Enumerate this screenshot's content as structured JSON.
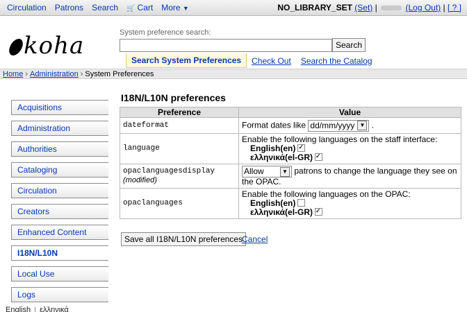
{
  "toolbar": {
    "nav": [
      {
        "label": "Circulation"
      },
      {
        "label": "Patrons"
      },
      {
        "label": "Search"
      },
      {
        "label": "Cart"
      },
      {
        "label": "More"
      }
    ],
    "library": "NO_LIBRARY_SET",
    "set_label": "(Set)",
    "logout_label": "(Log Out)",
    "help_label": "[ ? ]",
    "pipe": "|"
  },
  "logo_text": "koha",
  "search": {
    "label": "System preference search:",
    "value": "",
    "button": "Search",
    "tabs": [
      {
        "label": "Search System Preferences"
      },
      {
        "label": "Check Out"
      },
      {
        "label": "Search the Catalog"
      }
    ]
  },
  "breadcrumbs": [
    {
      "label": "Home"
    },
    {
      "label": "Administration"
    },
    {
      "label": "System Preferences"
    }
  ],
  "breadcrumb_sep": "›",
  "sidebar": {
    "items": [
      {
        "label": "Acquisitions"
      },
      {
        "label": "Administration"
      },
      {
        "label": "Authorities"
      },
      {
        "label": "Cataloging"
      },
      {
        "label": "Circulation"
      },
      {
        "label": "Creators"
      },
      {
        "label": "Enhanced Content"
      },
      {
        "label": "I18N/L10N"
      },
      {
        "label": "Local Use"
      },
      {
        "label": "Logs"
      }
    ],
    "active_index": 7
  },
  "main": {
    "title": "I18N/L10N preferences",
    "columns": [
      "Preference",
      "Value"
    ],
    "dateformat": {
      "name": "dateformat",
      "prefix": "Format dates like",
      "select": "dd/mm/yyyy",
      "suffix": "."
    },
    "language": {
      "name": "language",
      "intro": "Enable the following languages on the staff interface:",
      "options": [
        {
          "label": "English(en)",
          "checked": true
        },
        {
          "label": "ελληνικά(el-GR)",
          "checked": true
        }
      ]
    },
    "opaclanguagesdisplay": {
      "name": "opaclanguagesdisplay",
      "modified": "(modified)",
      "select": "Allow",
      "rest": "patrons to change the language they see on the OPAC."
    },
    "opaclanguages": {
      "name": "opaclanguages",
      "intro": "Enable the following languages on the OPAC:",
      "options": [
        {
          "label": "English(en)",
          "checked": false
        },
        {
          "label": "ελληνικά(el-GR)",
          "checked": true
        }
      ]
    },
    "save_label": "Save all I18N/L10N preferences",
    "cancel_label": "Cancel"
  },
  "langbar": {
    "items": [
      "English",
      "ελληνικά"
    ]
  }
}
